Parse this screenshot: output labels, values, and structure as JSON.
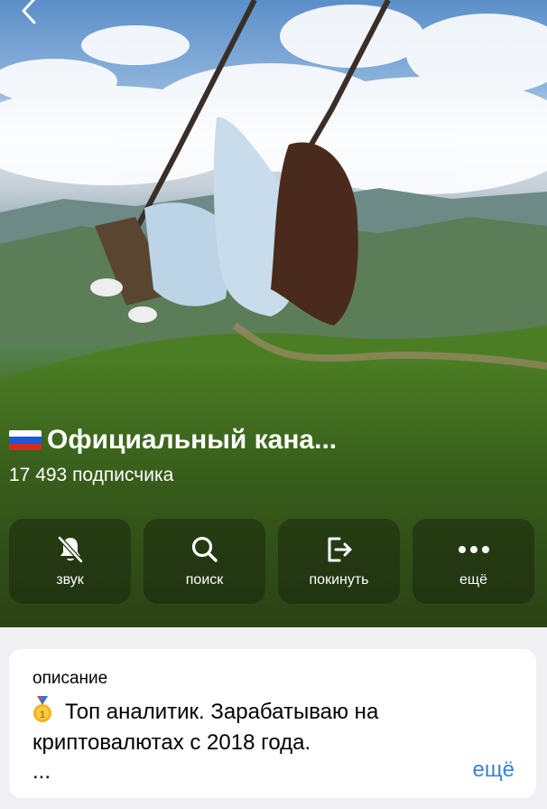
{
  "channel": {
    "title": "Официальный кана...",
    "subscribers": "17 493 подписчика",
    "flag_colors": [
      "#ffffff",
      "#1c57d8",
      "#d52b1e"
    ]
  },
  "actions": [
    {
      "label": "звук",
      "icon": "bell-mute-icon"
    },
    {
      "label": "поиск",
      "icon": "search-icon"
    },
    {
      "label": "покинуть",
      "icon": "exit-icon"
    },
    {
      "label": "ещё",
      "icon": "more-dots-icon"
    }
  ],
  "description": {
    "heading": "описание",
    "text": "Топ аналитик. Зарабатываю на криптовалютах с 2018 года.",
    "ellipsis": "...",
    "more_label": "ещё",
    "medal_icon": "gold-medal-icon"
  },
  "colors": {
    "accent": "#3b82d6",
    "background": "#efeff4"
  }
}
